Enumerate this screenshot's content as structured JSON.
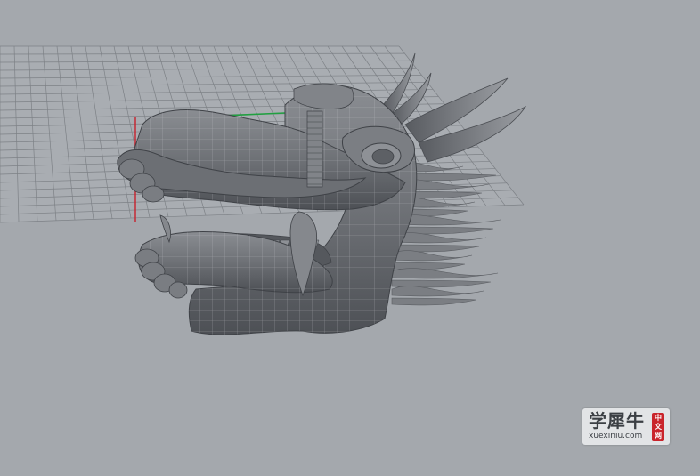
{
  "viewport": {
    "background_color": "#a4a8ad",
    "grid_color": "#7d8186",
    "x_axis_color": "#c8202b",
    "y_axis_color": "#20a040",
    "model": "dragon-head-mesh",
    "model_color": "#6e7176"
  },
  "watermark": {
    "cn_text": "学犀牛",
    "latin_text": "xuexiniu.com",
    "badge_chars": [
      "中",
      "文",
      "网"
    ],
    "badge_color": "#c9242b"
  }
}
